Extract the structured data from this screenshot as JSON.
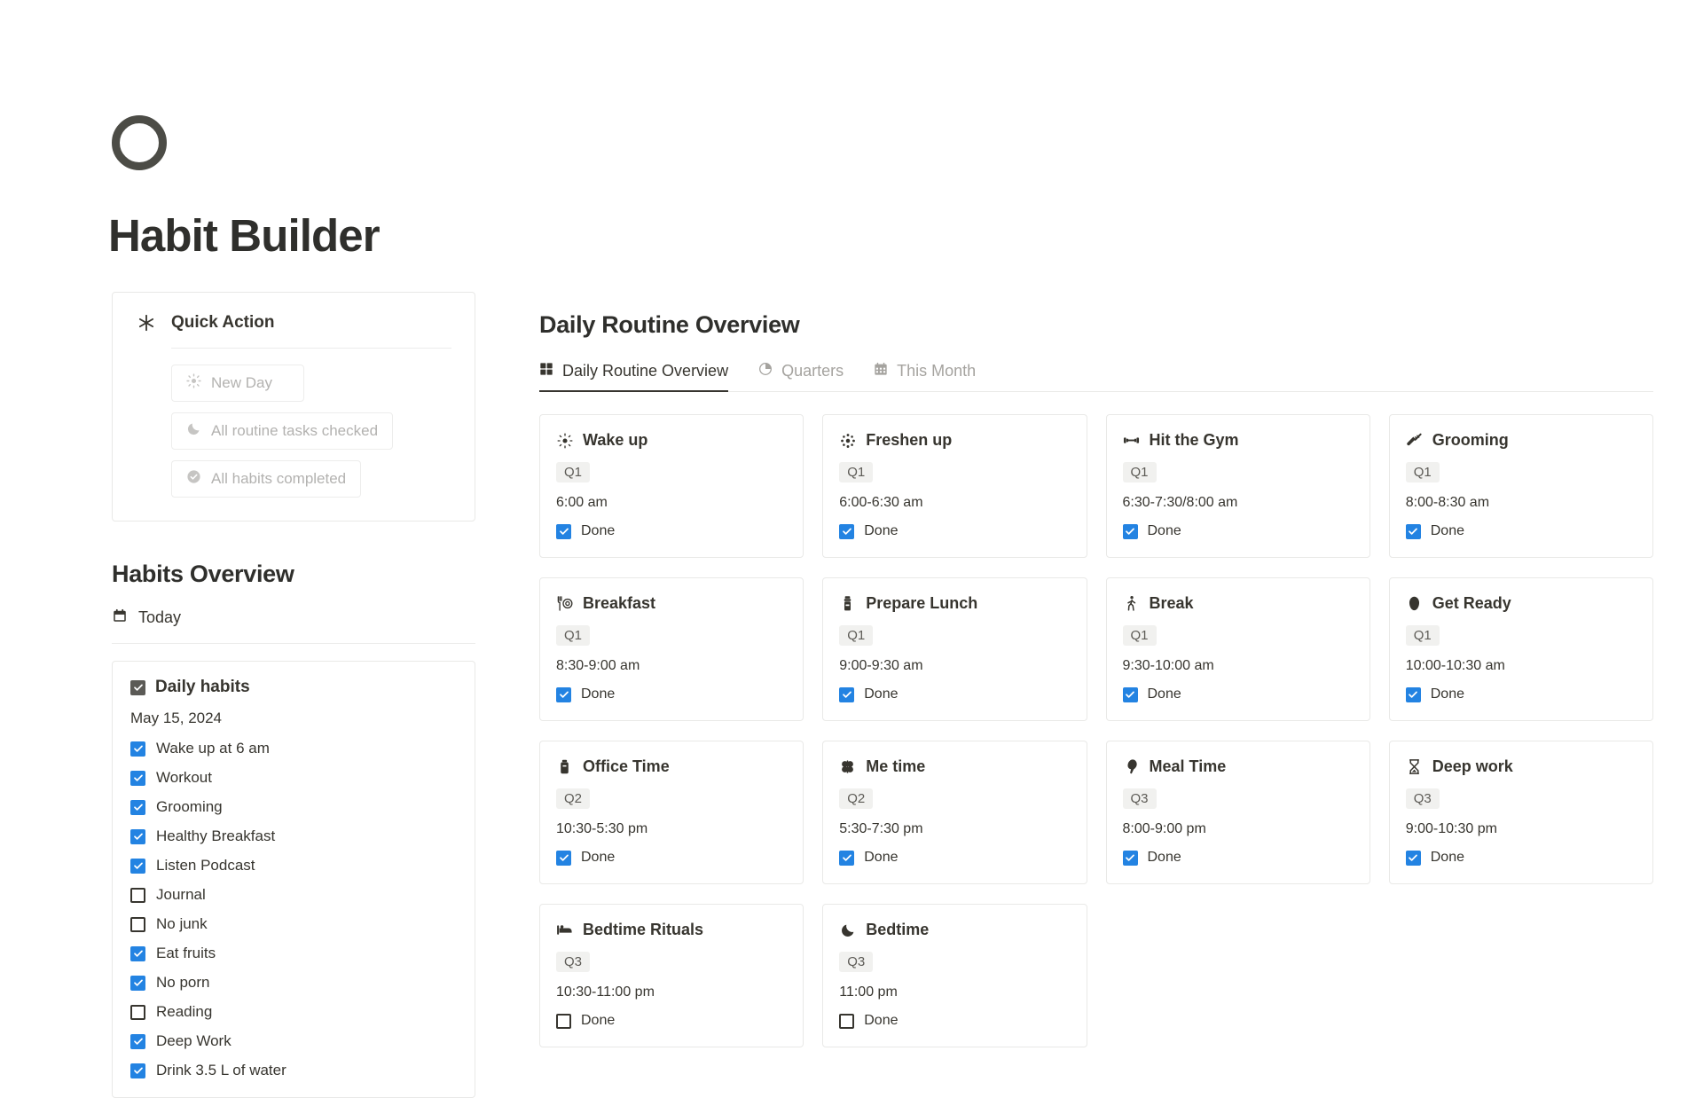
{
  "app": {
    "title": "Habit Builder",
    "logo_icon": "circle-outline-icon"
  },
  "quick_action": {
    "title": "Quick Action",
    "title_icon": "asterisk-icon",
    "buttons": [
      {
        "label": "New Day",
        "icon": "sun-icon"
      },
      {
        "label": "All routine tasks checked",
        "icon": "moon-icon"
      },
      {
        "label": "All habits completed",
        "icon": "check-circle-icon"
      }
    ]
  },
  "habits_overview": {
    "title": "Habits Overview",
    "today_label": "Today",
    "today_icon": "calendar-icon",
    "list": {
      "title": "Daily habits",
      "date": "May 15, 2024",
      "items": [
        {
          "label": "Wake up at 6 am",
          "checked": true
        },
        {
          "label": "Workout",
          "checked": true
        },
        {
          "label": "Grooming",
          "checked": true
        },
        {
          "label": "Healthy Breakfast",
          "checked": true
        },
        {
          "label": "Listen Podcast",
          "checked": true
        },
        {
          "label": "Journal",
          "checked": false
        },
        {
          "label": "No junk",
          "checked": false
        },
        {
          "label": "Eat fruits",
          "checked": true
        },
        {
          "label": "No porn",
          "checked": true
        },
        {
          "label": "Reading",
          "checked": false
        },
        {
          "label": "Deep Work",
          "checked": true
        },
        {
          "label": "Drink 3.5 L of water",
          "checked": true
        }
      ]
    }
  },
  "main": {
    "title": "Daily Routine Overview",
    "tabs": [
      {
        "label": "Daily Routine Overview",
        "icon": "grid-icon",
        "active": true
      },
      {
        "label": "Quarters",
        "icon": "pie-chart-icon",
        "active": false
      },
      {
        "label": "This Month",
        "icon": "calendar-grid-icon",
        "active": false
      }
    ],
    "done_label": "Done",
    "cards": [
      {
        "title": "Wake up",
        "icon": "sun-icon",
        "quarter": "Q1",
        "time": "6:00 am",
        "done": true
      },
      {
        "title": "Freshen up",
        "icon": "sparkle-icon",
        "quarter": "Q1",
        "time": "6:00-6:30 am",
        "done": true
      },
      {
        "title": "Hit the Gym",
        "icon": "dumbbell-icon",
        "quarter": "Q1",
        "time": "6:30-7:30/8:00 am",
        "done": true
      },
      {
        "title": "Grooming",
        "icon": "razor-icon",
        "quarter": "Q1",
        "time": "8:00-8:30 am",
        "done": true
      },
      {
        "title": "Breakfast",
        "icon": "fork-plate-icon",
        "quarter": "Q1",
        "time": "8:30-9:00 am",
        "done": true
      },
      {
        "title": "Prepare Lunch",
        "icon": "lunchbox-icon",
        "quarter": "Q1",
        "time": "9:00-9:30 am",
        "done": true
      },
      {
        "title": "Break",
        "icon": "walking-person-icon",
        "quarter": "Q1",
        "time": "9:30-10:00 am",
        "done": true
      },
      {
        "title": "Get Ready",
        "icon": "shirt-icon",
        "quarter": "Q1",
        "time": "10:00-10:30 am",
        "done": true
      },
      {
        "title": "Office Time",
        "icon": "briefcase-icon",
        "quarter": "Q2",
        "time": "10:30-5:30 pm",
        "done": true
      },
      {
        "title": "Me time",
        "icon": "clover-icon",
        "quarter": "Q2",
        "time": "5:30-7:30 pm",
        "done": true
      },
      {
        "title": "Meal Time",
        "icon": "chicken-icon",
        "quarter": "Q3",
        "time": "8:00-9:00 pm",
        "done": true
      },
      {
        "title": "Deep work",
        "icon": "hourglass-icon",
        "quarter": "Q3",
        "time": "9:00-10:30 pm",
        "done": true
      },
      {
        "title": "Bedtime Rituals",
        "icon": "bed-icon",
        "quarter": "Q3",
        "time": "10:30-11:00 pm",
        "done": false
      },
      {
        "title": "Bedtime",
        "icon": "moon-icon",
        "quarter": "Q3",
        "time": "11:00 pm",
        "done": false
      }
    ]
  },
  "colors": {
    "accent_blue": "#2383e2",
    "text": "#37352f",
    "muted": "#b3b2b0",
    "border": "#e9e9e7",
    "badge_bg": "#f1f1ef"
  }
}
